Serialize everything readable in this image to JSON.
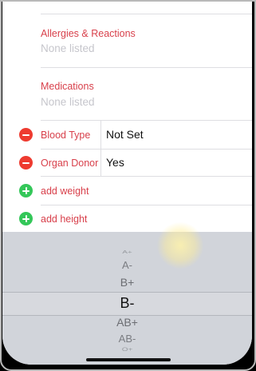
{
  "sections": [
    {
      "label": "Allergies & Reactions",
      "value": "None listed"
    },
    {
      "label": "Medications",
      "value": "None listed"
    }
  ],
  "rows": [
    {
      "label": "Blood Type",
      "value": "Not Set",
      "icon": "minus-circle-icon"
    },
    {
      "label": "Organ Donor",
      "value": "Yes",
      "icon": "minus-circle-icon"
    },
    {
      "label": "add weight",
      "icon": "plus-circle-icon"
    },
    {
      "label": "add height",
      "icon": "plus-circle-icon"
    }
  ],
  "picker": {
    "items": [
      "A+",
      "A-",
      "B+",
      "B-",
      "AB+",
      "AB-",
      "O+"
    ],
    "selected": "B-"
  },
  "colors": {
    "label_red": "#d8404b",
    "minus_red": "#ee3b30",
    "plus_green": "#34c759",
    "placeholder_gray": "#c6c6cc",
    "picker_bg": "#d1d4da"
  }
}
